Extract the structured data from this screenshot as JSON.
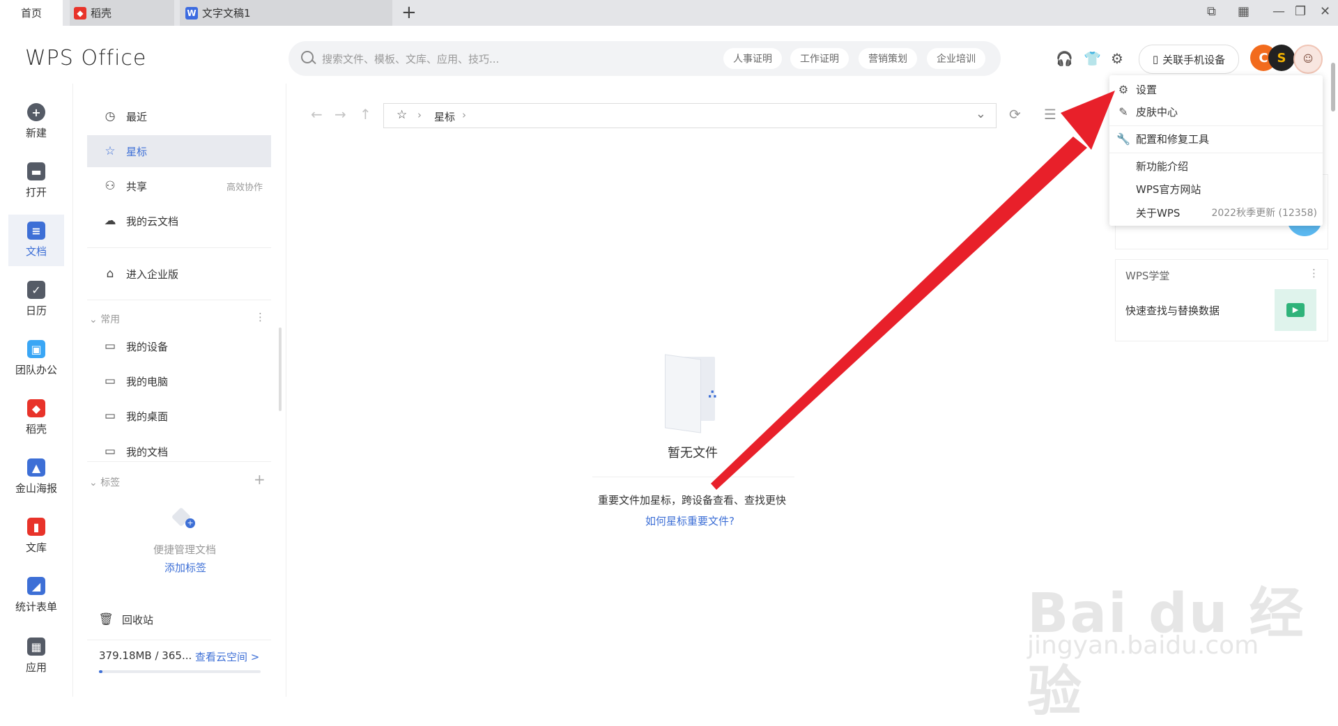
{
  "tabs": [
    {
      "label": "首页"
    },
    {
      "label": "稻壳",
      "color": "#e8332a"
    },
    {
      "label": "文字文稿1",
      "color": "#3c6be0"
    }
  ],
  "header": {
    "logo": "WPS Office",
    "search_placeholder": "搜索文件、模板、文库、应用、技巧...",
    "chips": [
      "人事证明",
      "工作证明",
      "营销策划",
      "企业培训"
    ],
    "link_device": "关联手机设备"
  },
  "rail": [
    {
      "label": "新建",
      "icon": "plus-circle-icon",
      "color": "#555b66"
    },
    {
      "label": "打开",
      "icon": "folder-icon",
      "color": "#555b66"
    },
    {
      "label": "文档",
      "icon": "document-icon",
      "color": "#3d6fd6"
    },
    {
      "label": "日历",
      "icon": "calendar-icon",
      "color": "#555b66"
    },
    {
      "label": "团队办公",
      "icon": "team-icon",
      "color": "#3aa6f5"
    },
    {
      "label": "稻壳",
      "icon": "daoke-icon",
      "color": "#e8332a"
    },
    {
      "label": "金山海报",
      "icon": "poster-icon",
      "color": "#3d6fd6"
    },
    {
      "label": "文库",
      "icon": "library-icon",
      "color": "#e8332a"
    },
    {
      "label": "统计表单",
      "icon": "form-icon",
      "color": "#3d6fd6"
    },
    {
      "label": "应用",
      "icon": "apps-icon",
      "color": "#555b66"
    }
  ],
  "nav": {
    "recent": "最近",
    "starred": "星标",
    "shared": "共享",
    "shared_extra": "高效协作",
    "cloud": "我的云文档",
    "enterprise": "进入企业版",
    "common_group": "常用",
    "my_device": "我的设备",
    "my_pc": "我的电脑",
    "my_desktop": "我的桌面",
    "my_docs": "我的文档",
    "tags_group": "标签",
    "tags_hint": "便捷管理文档",
    "add_tag": "添加标签",
    "recycle": "回收站",
    "storage": "379.18MB / 365...",
    "storage_link": "查看云空间 >",
    "storage_fill": 0.02
  },
  "main": {
    "breadcrumb": "星标",
    "empty_title": "暂无文件",
    "empty_desc": "重要文件加星标，跨设备查看、查找更快",
    "empty_link": "如何星标重要文件?"
  },
  "card": {
    "title": "WPS学堂",
    "text": "快速查找与替换数据"
  },
  "menu": {
    "settings": "设置",
    "skin": "皮肤中心",
    "repair": "配置和修复工具",
    "new_features": "新功能介绍",
    "website": "WPS官方网站",
    "about": "关于WPS",
    "version": "2022秋季更新 (12358)"
  },
  "watermark": {
    "main": "Bai du 经验",
    "sub": "jingyan.baidu.com"
  },
  "colors": {
    "accent": "#3d6fd6",
    "arrow": "#e8202a"
  }
}
